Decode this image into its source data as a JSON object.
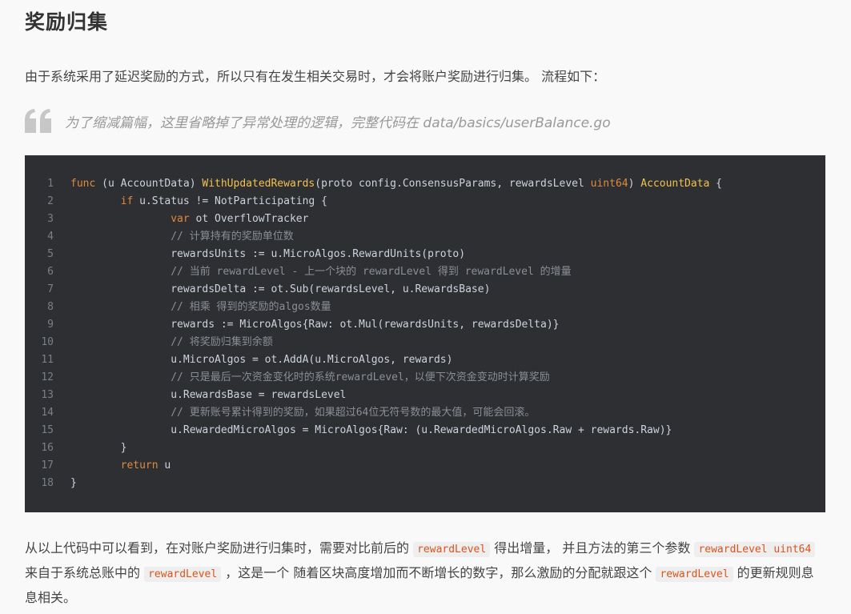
{
  "heading": "奖励归集",
  "intro": "由于系统采用了延迟奖励的方式，所以只有在发生相关交易时，才会将账户奖励进行归集。 流程如下：",
  "quote": {
    "icon": "quote-icon",
    "text": "为了缩减篇幅，这里省略掉了异常处理的逻辑，完整代码在 data/basics/userBalance.go"
  },
  "code": {
    "lines": [
      {
        "n": "1",
        "indent": "",
        "tokens": [
          {
            "t": "func",
            "c": "kw"
          },
          {
            "t": " (u AccountData) ",
            "c": ""
          },
          {
            "t": "WithUpdatedRewards",
            "c": "fn"
          },
          {
            "t": "(proto config.ConsensusParams, rewardsLevel ",
            "c": ""
          },
          {
            "t": "uint64",
            "c": "kw"
          },
          {
            "t": ") ",
            "c": ""
          },
          {
            "t": "AccountData",
            "c": "ty"
          },
          {
            "t": " {",
            "c": ""
          }
        ]
      },
      {
        "n": "2",
        "indent": "        ",
        "tokens": [
          {
            "t": "if",
            "c": "kw"
          },
          {
            "t": " u.Status != NotParticipating {",
            "c": ""
          }
        ]
      },
      {
        "n": "3",
        "indent": "                ",
        "tokens": [
          {
            "t": "var",
            "c": "kw"
          },
          {
            "t": " ot OverflowTracker",
            "c": ""
          }
        ]
      },
      {
        "n": "4",
        "indent": "                ",
        "tokens": [
          {
            "t": "// 计算持有的奖励单位数",
            "c": "cm"
          }
        ]
      },
      {
        "n": "5",
        "indent": "                ",
        "tokens": [
          {
            "t": "rewardsUnits := u.MicroAlgos.RewardUnits(proto)",
            "c": ""
          }
        ]
      },
      {
        "n": "6",
        "indent": "                ",
        "tokens": [
          {
            "t": "// 当前 rewardLevel - 上一个块的 rewardLevel 得到 rewardLevel 的增量",
            "c": "cm"
          }
        ]
      },
      {
        "n": "7",
        "indent": "                ",
        "tokens": [
          {
            "t": "rewardsDelta := ot.Sub(rewardsLevel, u.RewardsBase)",
            "c": ""
          }
        ]
      },
      {
        "n": "8",
        "indent": "                ",
        "tokens": [
          {
            "t": "// 相乘 得到的奖励的algos数量",
            "c": "cm"
          }
        ]
      },
      {
        "n": "9",
        "indent": "                ",
        "tokens": [
          {
            "t": "rewards := MicroAlgos{Raw: ot.Mul(rewardsUnits, rewardsDelta)}",
            "c": ""
          }
        ]
      },
      {
        "n": "10",
        "indent": "                ",
        "tokens": [
          {
            "t": "// 将奖励归集到余额",
            "c": "cm"
          }
        ]
      },
      {
        "n": "11",
        "indent": "                ",
        "tokens": [
          {
            "t": "u.MicroAlgos = ot.AddA(u.MicroAlgos, rewards)",
            "c": ""
          }
        ]
      },
      {
        "n": "12",
        "indent": "                ",
        "tokens": [
          {
            "t": "// 只是最后一次资金变化时的系统rewardLevel，以便下次资金变动时计算奖励",
            "c": "cm"
          }
        ]
      },
      {
        "n": "13",
        "indent": "                ",
        "tokens": [
          {
            "t": "u.RewardsBase = rewardsLevel",
            "c": ""
          }
        ]
      },
      {
        "n": "14",
        "indent": "                ",
        "tokens": [
          {
            "t": "// 更新账号累计得到的奖励，如果超过64位无符号数的最大值，可能会回滚。",
            "c": "cm"
          }
        ]
      },
      {
        "n": "15",
        "indent": "                ",
        "tokens": [
          {
            "t": "u.RewardedMicroAlgos = MicroAlgos{Raw: (u.RewardedMicroAlgos.Raw + rewards.Raw)}",
            "c": ""
          }
        ]
      },
      {
        "n": "16",
        "indent": "        ",
        "tokens": [
          {
            "t": "}",
            "c": ""
          }
        ]
      },
      {
        "n": "17",
        "indent": "        ",
        "tokens": [
          {
            "t": "return",
            "c": "kw"
          },
          {
            "t": " u",
            "c": ""
          }
        ]
      },
      {
        "n": "18",
        "indent": "",
        "tokens": [
          {
            "t": "}",
            "c": ""
          }
        ]
      }
    ]
  },
  "after": {
    "parts": [
      {
        "t": "从以上代码中可以看到，在对账户奖励进行归集时，需要对比前后的 ",
        "code": false
      },
      {
        "t": "rewardLevel",
        "code": true
      },
      {
        "t": " 得出增量，  并且方法的第三个参数 ",
        "code": false
      },
      {
        "t": "rewardLevel uint64",
        "code": true
      },
      {
        "t": " 来自于系统总账中的 ",
        "code": false
      },
      {
        "t": "rewardLevel",
        "code": true
      },
      {
        "t": " ，这是一个 随着区块高度增加而不断增长的数字，那么激励的分配就跟这个 ",
        "code": false
      },
      {
        "t": "rewardLevel",
        "code": true
      },
      {
        "t": " 的更新规则息 息相关。",
        "code": false
      }
    ]
  }
}
